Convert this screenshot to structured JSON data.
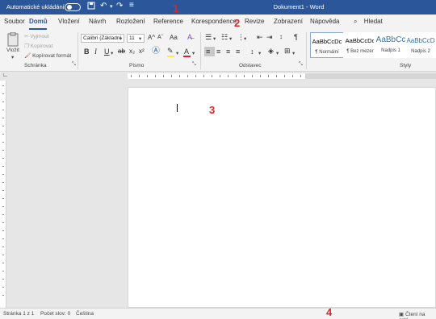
{
  "titlebar": {
    "autosave_label": "Automatické ukládání",
    "save_icon": "save-icon",
    "undo_icon": "undo-icon",
    "redo_icon": "redo-icon",
    "customize_icon": "customize-qat-icon",
    "document_title": "Dokument1 - Word",
    "color": "#2b579a"
  },
  "markers": [
    "1",
    "2",
    "3",
    "4"
  ],
  "tabs": [
    {
      "label": "Soubor"
    },
    {
      "label": "Domů",
      "active": true
    },
    {
      "label": "Vložení"
    },
    {
      "label": "Návrh"
    },
    {
      "label": "Rozložení"
    },
    {
      "label": "Reference"
    },
    {
      "label": "Korespondence"
    },
    {
      "label": "Revize"
    },
    {
      "label": "Zobrazení"
    },
    {
      "label": "Nápověda"
    }
  ],
  "search": {
    "label": "Hledat",
    "icon": "search-icon"
  },
  "ribbon": {
    "clipboard": {
      "paste_label": "Vložit",
      "cut_label": "Vyjmout",
      "copy_label": "Kopírovat",
      "format_painter_label": "Kopírovat formát",
      "group_label": "Schránka"
    },
    "font": {
      "font_name": "Calibri (Základní",
      "font_size": "11",
      "group_label": "Písmo",
      "bold": "B",
      "italic": "I",
      "underline": "U",
      "strike": "ab",
      "subscript": "x₂",
      "superscript": "x²",
      "grow": "A^",
      "shrink": "Aˇ",
      "case": "Aa",
      "color_text": "A"
    },
    "paragraph": {
      "group_label": "Odstavec"
    },
    "styles": {
      "group_label": "Styly",
      "items": [
        {
          "sample": "AaBbCcDc",
          "name": "¶ Normální",
          "selected": true
        },
        {
          "sample": "AaBbCcDc",
          "name": "¶ Bez mezer"
        },
        {
          "sample": "AaBbCc",
          "name": "Nadpis 1"
        },
        {
          "sample": "AaBbCcD",
          "name": "Nadpis 2"
        }
      ]
    }
  },
  "statusbar": {
    "page": "Stránka 1 z 1",
    "words": "Počet slov: 0",
    "language": "Čeština",
    "focus": "Čtení na celé"
  }
}
